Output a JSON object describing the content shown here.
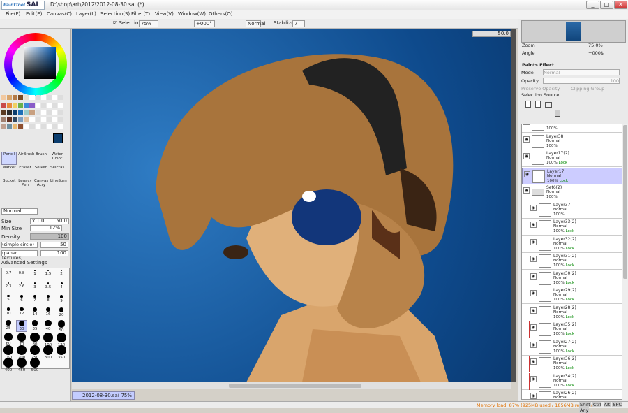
{
  "title": {
    "logo_small": "PaintTool",
    "logo": "SAI",
    "path": "D:\\shop\\art\\2012\\2012-08-30.sai (*)"
  },
  "window_buttons": [
    "_",
    "□",
    "✕"
  ],
  "menu": [
    "File(F)",
    "Edit(E)",
    "Canvas(C)",
    "Layer(L)",
    "Selection(S)",
    "Filter(T)",
    "View(V)",
    "Window(W)",
    "Others(O)"
  ],
  "toolbar": {
    "selection_label": "Selection",
    "zoom": "75%",
    "angle": "+000°",
    "mode": "Normal",
    "stabilizer_label": "Stabilizer",
    "stabilizer": "7"
  },
  "tools": {
    "pencil": "Pencil",
    "airbrush": "AirBrush",
    "brush": "Brush",
    "water": "Water Color",
    "marker": "Marker",
    "eraser": "Eraser",
    "selpen": "SelPen",
    "selers": "SelEras",
    "bucket": "Bucket",
    "legacy": "Legacy Pen",
    "canvas_acry": "Canvas Acry",
    "linesom": "LineSom"
  },
  "brush": {
    "mode": "Normal",
    "size_label": "Size",
    "size_mult": "x 1.0",
    "size": "50.0",
    "minsize_label": "Min Size",
    "minsize": "12%",
    "density_label": "Density",
    "density": "100",
    "shape": "(simple circle)",
    "shape_val": "50",
    "texture": "(paper textures)",
    "texture_val": "100",
    "advanced": "Advanced Settings"
  },
  "brush_sizes": [
    "0.7",
    "0.8",
    "1",
    "1.5",
    "2",
    "2.3",
    "2.6",
    "3",
    "3.5",
    "4",
    "5",
    "6",
    "7",
    "8",
    "9",
    "10",
    "12",
    "14",
    "16",
    "20",
    "25",
    "30",
    "35",
    "40",
    "50",
    "60",
    "70",
    "80",
    "100",
    "120",
    "160",
    "200",
    "250",
    "300",
    "350",
    "400",
    "450",
    "500"
  ],
  "canvas": {
    "zoom": "50.0"
  },
  "doc_tab": {
    "name": "2012-08-30.sai",
    "zoom": "75%"
  },
  "status": {
    "memory": "Memory load: 87% (925MB used / 1856MB reserved)",
    "keys": [
      "Shift",
      "Ctrl",
      "Alt",
      "SPC",
      "Any"
    ]
  },
  "navigator": {
    "zoom_label": "Zoom",
    "zoom": "75.0%",
    "angle_label": "Angle",
    "angle": "+000$"
  },
  "paints_effect": {
    "title": "Paints Effect",
    "mode_label": "Mode",
    "mode": "Normal",
    "opacity_label": "Opacity",
    "opacity": "100",
    "preserve": "Preserve Opacity",
    "clipping": "Clipping Group",
    "selection_source": "Selection Source"
  },
  "layers": [
    {
      "name": "",
      "mode": "",
      "opacity": "100%",
      "lock": ""
    },
    {
      "name": "Layer38",
      "mode": "Normal",
      "opacity": "100%",
      "lock": ""
    },
    {
      "name": "Layer17(2)",
      "mode": "Normal",
      "opacity": "100%",
      "lock": "Lock"
    },
    {
      "name": "Layer17",
      "mode": "Normal",
      "opacity": "100%",
      "lock": "Lock"
    },
    {
      "name": "Set6(2)",
      "mode": "Normal",
      "opacity": "100%",
      "lock": ""
    },
    {
      "name": "Layer37",
      "mode": "Normal",
      "opacity": "100%",
      "lock": ""
    },
    {
      "name": "Layer33(2)",
      "mode": "Normal",
      "opacity": "100%",
      "lock": "Lock"
    },
    {
      "name": "Layer32(2)",
      "mode": "Normal",
      "opacity": "100%",
      "lock": "Lock"
    },
    {
      "name": "Layer31(2)",
      "mode": "Normal",
      "opacity": "100%",
      "lock": "Lock"
    },
    {
      "name": "Layer30(2)",
      "mode": "Normal",
      "opacity": "100%",
      "lock": "Lock"
    },
    {
      "name": "Layer29(2)",
      "mode": "Normal",
      "opacity": "100%",
      "lock": "Lock"
    },
    {
      "name": "Layer28(2)",
      "mode": "Normal",
      "opacity": "100%",
      "lock": "Lock"
    },
    {
      "name": "Layer35(2)",
      "mode": "Normal",
      "opacity": "100%",
      "lock": "Lock"
    },
    {
      "name": "Layer27(2)",
      "mode": "Normal",
      "opacity": "100%",
      "lock": "Lock"
    },
    {
      "name": "Layer36(2)",
      "mode": "Normal",
      "opacity": "100%",
      "lock": "Lock"
    },
    {
      "name": "Layer34(2)",
      "mode": "Normal",
      "opacity": "100%",
      "lock": "Lock"
    },
    {
      "name": "Layer26(2)",
      "mode": "Normal",
      "opacity": "",
      "lock": ""
    }
  ],
  "colors": {
    "accent": "#c3ccff",
    "canvas_blue": "#0e4a8c",
    "hair": "#a8743c",
    "skin": "#d9a56c",
    "primary_color": "#0b3d6e"
  }
}
